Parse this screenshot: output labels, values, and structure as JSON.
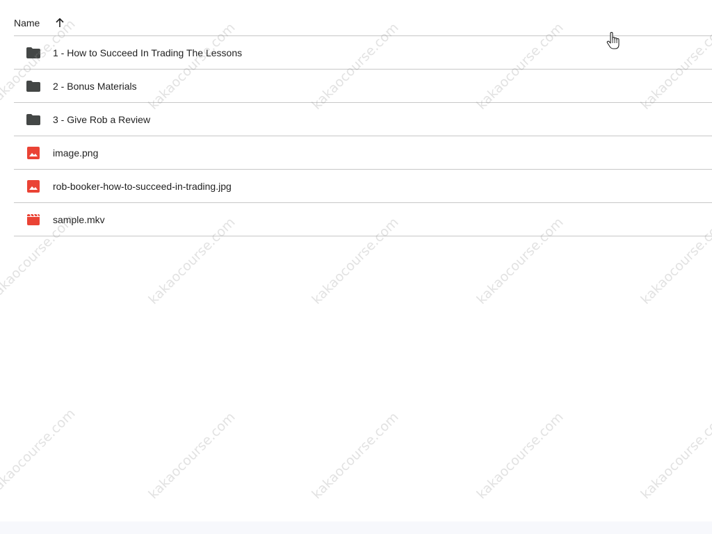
{
  "header": {
    "name_label": "Name",
    "sort_direction": "ascending"
  },
  "files": [
    {
      "name": "1 - How to Succeed In Trading The Lessons",
      "icon": "folder-icon"
    },
    {
      "name": "2 - Bonus Materials",
      "icon": "folder-icon"
    },
    {
      "name": "3 - Give Rob a Review",
      "icon": "folder-icon"
    },
    {
      "name": "image.png",
      "icon": "image-icon"
    },
    {
      "name": "rob-booker-how-to-succeed-in-trading.jpg",
      "icon": "image-icon"
    },
    {
      "name": "sample.mkv",
      "icon": "video-icon"
    }
  ],
  "watermark": "kakaocourse.com",
  "colors": {
    "folder": "#444746",
    "image": "#ea4335",
    "video": "#ea4335",
    "divider": "#c7c7c7",
    "text": "#1f1f1f"
  }
}
